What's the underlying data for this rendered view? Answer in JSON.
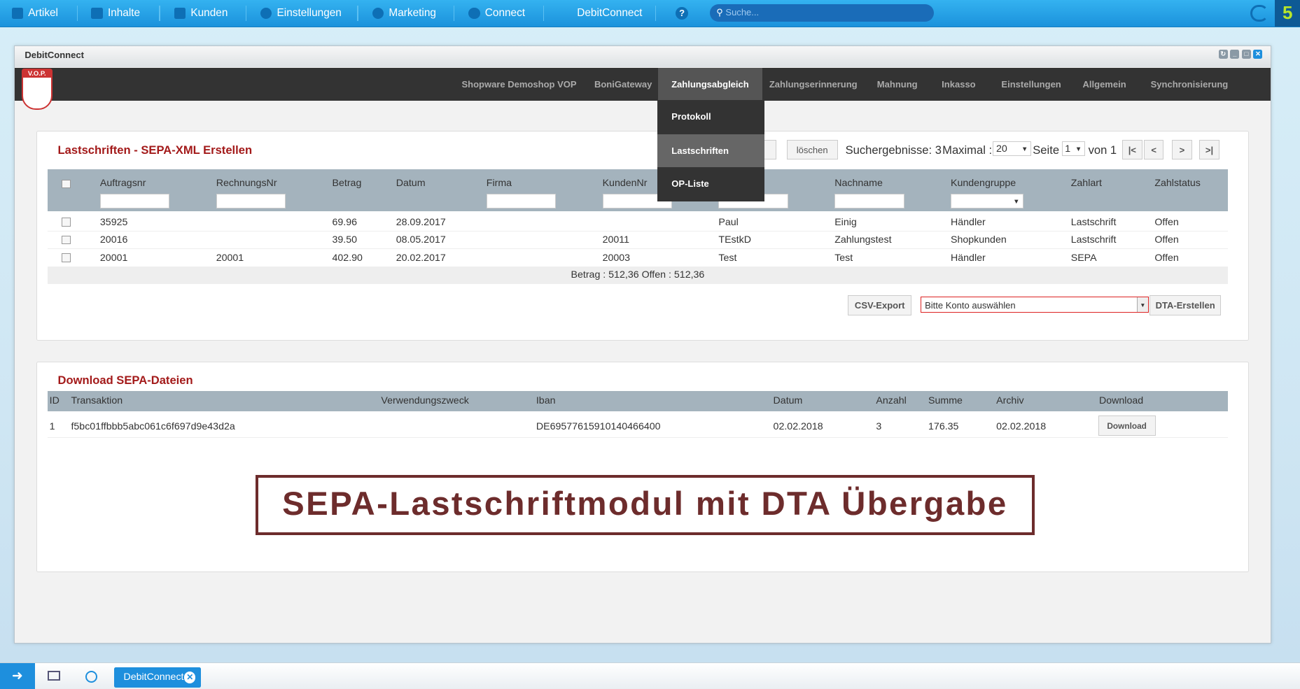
{
  "topbar": {
    "items": [
      {
        "label": "Artikel",
        "icon": "mail-icon"
      },
      {
        "label": "Inhalte",
        "icon": "document-icon"
      },
      {
        "label": "Kunden",
        "icon": "users-icon"
      },
      {
        "label": "Einstellungen",
        "icon": "gear-icon"
      },
      {
        "label": "Marketing",
        "icon": "pie-chart-icon"
      },
      {
        "label": "Connect",
        "icon": "connect-icon"
      },
      {
        "label": "DebitConnect"
      }
    ],
    "help": "?",
    "search_placeholder": "Suche..."
  },
  "window": {
    "title": "DebitConnect",
    "logo_text": "V.O.P."
  },
  "nav": {
    "items": [
      "Shopware Demoshop VOP",
      "BoniGateway",
      "Zahlungsabgleich",
      "Zahlungserinnerung",
      "Mahnung",
      "Inkasso",
      "Einstellungen",
      "Allgemein",
      "Synchronisierung"
    ],
    "active": "Zahlungsabgleich"
  },
  "dropdown": {
    "items": [
      "Protokoll",
      "Lastschriften",
      "OP-Liste"
    ],
    "highlighted": "Lastschriften"
  },
  "panel1": {
    "title": "Lastschriften - SEPA-XML Erstellen",
    "delete_label": "löschen",
    "results": "Suchergebnisse: 3",
    "max_label": "Maximal :",
    "max_value": "20",
    "page_label": "Seite",
    "page_value": "1",
    "of_label": "von 1",
    "pager": [
      "|<",
      "<",
      ">",
      ">|"
    ],
    "columns": [
      "Auftragsnr",
      "RechnungsNr",
      "Betrag",
      "Datum",
      "Firma",
      "KundenNr",
      "Nachname",
      "Kundengruppe",
      "Zahlart",
      "Zahlstatus"
    ],
    "rows": [
      {
        "auftrag": "35925",
        "rechnung": "",
        "betrag": "69.96",
        "datum": "28.09.2017",
        "firma": "",
        "kundennr": "",
        "vorname": "Paul",
        "nachname": "Einig",
        "gruppe": "Händler",
        "zahlart": "Lastschrift",
        "status": "Offen"
      },
      {
        "auftrag": "20016",
        "rechnung": "",
        "betrag": "39.50",
        "datum": "08.05.2017",
        "firma": "",
        "kundennr": "20011",
        "vorname": "TEstkD",
        "nachname": "Zahlungstest",
        "gruppe": "Shopkunden",
        "zahlart": "Lastschrift",
        "status": "Offen"
      },
      {
        "auftrag": "20001",
        "rechnung": "20001",
        "betrag": "402.90",
        "datum": "20.02.2017",
        "firma": "",
        "kundennr": "20003",
        "vorname": "Test",
        "nachname": "Test",
        "gruppe": "Händler",
        "zahlart": "SEPA",
        "status": "Offen"
      }
    ],
    "total": "Betrag : 512,36 Offen : 512,36",
    "csv_label": "CSV-Export",
    "account_select": "Bitte Konto auswählen",
    "dta_label": "DTA-Erstellen"
  },
  "panel2": {
    "title": "Download SEPA-Dateien",
    "columns": [
      "ID",
      "Transaktion",
      "Verwendungszweck",
      "Iban",
      "Datum",
      "Anzahl",
      "Summe",
      "Archiv",
      "Download"
    ],
    "rows": [
      {
        "id": "1",
        "transaktion": "f5bc01ffbbb5abc061c6f697d9e43d2a",
        "zweck": "",
        "iban": "DE69577615910140466400",
        "datum": "02.02.2018",
        "anzahl": "3",
        "summe": "176.35",
        "archiv": "02.02.2018",
        "download": "Download"
      }
    ]
  },
  "banner": "SEPA-Lastschriftmodul mit DTA Übergabe",
  "taskbar": {
    "tab": "DebitConnect"
  },
  "colors": {
    "topbar": "#1b92dc",
    "accent_red": "#a31a1a",
    "nav_bg": "#333333",
    "banner": "#6d2c2c"
  }
}
